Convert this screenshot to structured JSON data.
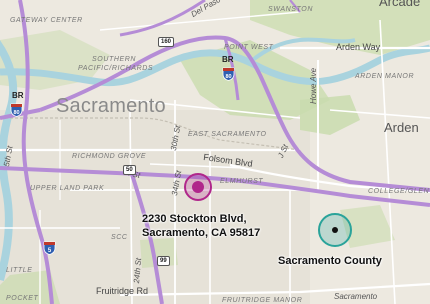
{
  "map": {
    "city_label": "Sacramento",
    "area_labels": {
      "gateway_center": "GATEWAY CENTER",
      "southern_pacific_1": "SOUTHERN",
      "southern_pacific_2": "PACIFIC/RICHARDS",
      "point_west": "POINT WEST",
      "arden_manor": "ARDEN MANOR",
      "arden": "Arden",
      "east_sacramento": "EAST SACRAMENTO",
      "richmond_grove": "RICHMOND GROVE",
      "upper_land_park": "UPPER LAND PARK",
      "elmhurst": "ELMHURST",
      "college_glen": "COLLEGE/GLEN",
      "scc": "SCC",
      "fruitridge_manor": "FRUITRIDGE MANOR",
      "little": "LITTLE",
      "pocket": "POCKET",
      "arcade": "Arcade"
    },
    "road_labels": {
      "del_paso": "Del Paso",
      "swanston": "SWANSTON",
      "arden_way": "Arden Way",
      "howe_ave": "Howe Ave",
      "folsom_blvd": "Folsom Blvd",
      "x_st": "X St",
      "th_30": "30th St",
      "th_34": "34th St",
      "st_j": "J St",
      "th_24": "24th St",
      "fruitridge_rd": "Fruitridge Rd",
      "sacramento_bottom": "Sacramento",
      "st_5": "5th St"
    },
    "shields": {
      "sr_160": "160",
      "sr_50": "50",
      "sr_99": "99",
      "br_1": "BR",
      "br_2": "BR",
      "i80_1": "80",
      "i80_2": "80",
      "i5": "5"
    },
    "markers": [
      {
        "label_line1": "2230 Stockton Blvd,",
        "label_line2": "Sacramento, CA 95817",
        "color": "#b0278b"
      },
      {
        "label_line1": "Sacramento County",
        "label_line2": "",
        "color": "#2aa39a"
      }
    ],
    "colors": {
      "land": "#ede9e0",
      "park": "#c9dcae",
      "water": "#a9d3de",
      "freeway": "#b58cd6",
      "major_road": "#ffffff",
      "rail": "#c4bfb3"
    }
  }
}
